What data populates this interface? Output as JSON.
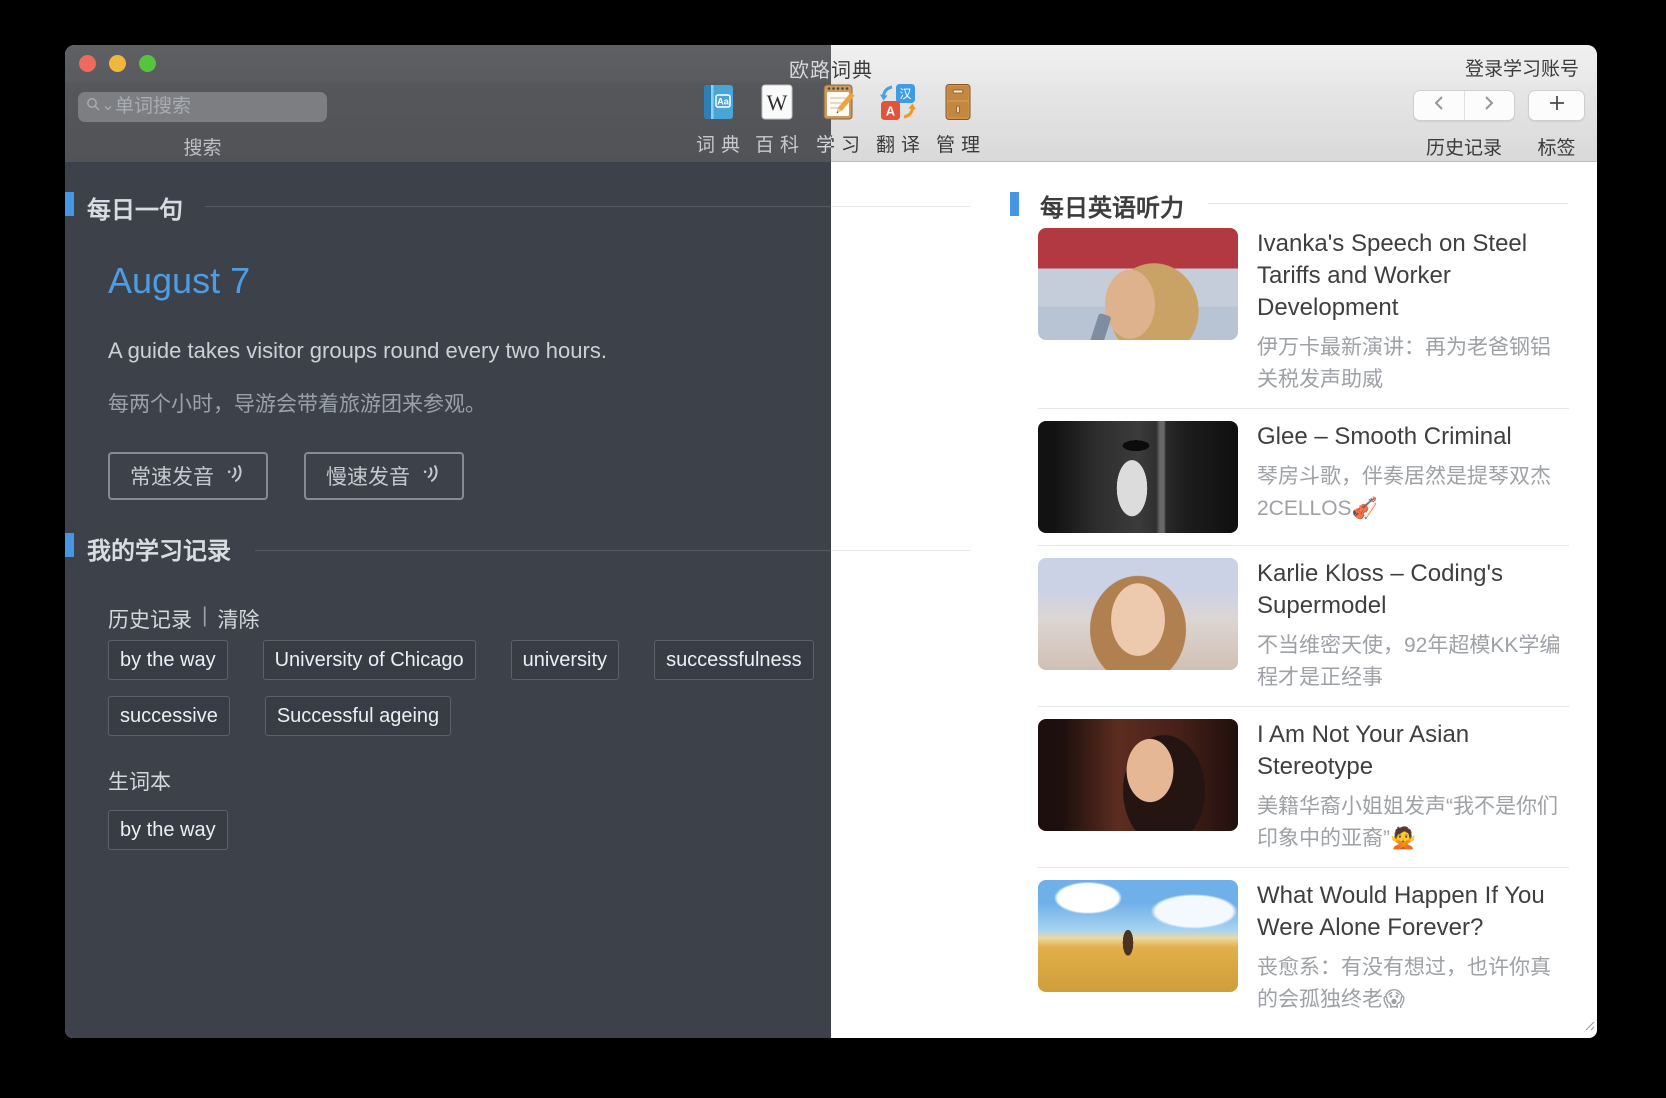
{
  "titlebar": {
    "title": "欧路词典",
    "login_label": "登录学习账号"
  },
  "toolbar": {
    "search": {
      "placeholder": "单词搜索",
      "label": "搜索"
    },
    "tools": [
      {
        "label": "词典",
        "icon": "dictionary-book-icon"
      },
      {
        "label": "百科",
        "icon": "wikipedia-icon"
      },
      {
        "label": "学习",
        "icon": "study-notepad-icon"
      },
      {
        "label": "翻译",
        "icon": "translate-icon"
      },
      {
        "label": "管理",
        "icon": "manage-cabinet-icon"
      }
    ],
    "history_nav_label": "历史记录",
    "tags_label": "标签"
  },
  "daily_sentence": {
    "section_title": "每日一句",
    "date": "August 7",
    "sentence_en": "A guide takes visitor groups round every two hours.",
    "sentence_zh": "每两个小时，导游会带着旅游团来参观。",
    "normal_speed_label": "常速发音",
    "slow_speed_label": "慢速发音"
  },
  "study_records": {
    "section_title": "我的学习记录",
    "history_label": "历史记录",
    "separator": "|",
    "clear_label": "清除",
    "history_rows": [
      [
        "by the way",
        "University of Chicago",
        "university",
        "successfulness"
      ],
      [
        "successive",
        "Successful ageing"
      ]
    ],
    "wordbook_label": "生词本",
    "wordbook_tags": [
      "by the way"
    ]
  },
  "daily_listening": {
    "section_title": "每日英语听力",
    "items": [
      {
        "title": "Ivanka's Speech on Steel Tariffs and Worker Development",
        "subtitle": "伊万卡最新演讲：再为老爸钢铝关税发声助威",
        "thumb_name": "thumbnail-ivanka-speech"
      },
      {
        "title": "Glee – Smooth Criminal",
        "subtitle": "琴房斗歌，伴奏居然是提琴双杰2CELLOS🎻",
        "thumb_name": "thumbnail-glee-smooth-criminal"
      },
      {
        "title": "Karlie Kloss – Coding's Supermodel",
        "subtitle": "不当维密天使，92年超模KK学编程才是正经事",
        "thumb_name": "thumbnail-karlie-kloss-coding"
      },
      {
        "title": "I Am Not Your Asian Stereotype",
        "subtitle": "美籍华裔小姐姐发声“我不是你们印象中的亚裔”🙅",
        "thumb_name": "thumbnail-asian-stereotype"
      },
      {
        "title": "What Would Happen If You Were Alone Forever?",
        "subtitle": "丧愈系：有没有想过，也许你真的会孤独终老😱",
        "thumb_name": "thumbnail-alone-forever"
      }
    ]
  },
  "colors": {
    "accent_blue": "#4796e3",
    "date_blue": "#4c9de4",
    "dark_panel": "#3c414a"
  }
}
